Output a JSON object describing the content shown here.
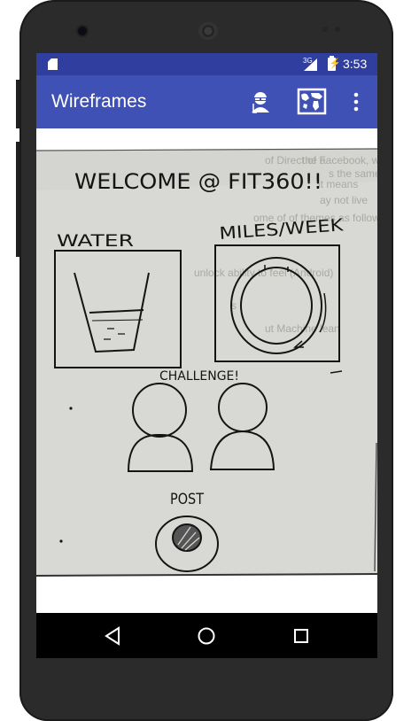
{
  "status_bar": {
    "network_type": "3G",
    "time": "3:53",
    "icons": [
      "sd-card-icon",
      "signal-icon",
      "battery-charging-icon"
    ]
  },
  "app_bar": {
    "title": "Wireframes",
    "actions": [
      "face-detection-icon",
      "map-icon",
      "overflow-menu-icon"
    ],
    "color": "#3f51b5",
    "status_color": "#303f9f"
  },
  "sketch": {
    "header": "WELCOME @ FIT360!!",
    "water_label": "WATER",
    "miles_label": "MILES/WEEK",
    "challenge_label": "CHALLENGE!",
    "post_label": "POST",
    "background_text": [
      "the a",
      "it means",
      "ay not live",
      "of Direct of Facebook, we fo",
      "s the same machines e.g. Instead",
      "ome of of themes as follows:",
      "unlock ability to feel (Android)",
      "s",
      "ut Machine lean"
    ]
  },
  "nav_bar": {
    "buttons": [
      "back-icon",
      "home-icon",
      "recents-icon"
    ]
  }
}
